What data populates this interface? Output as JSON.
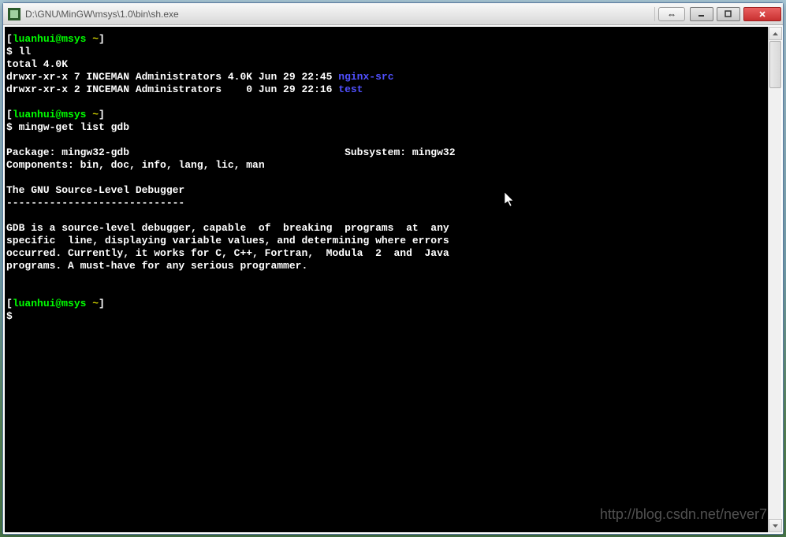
{
  "window": {
    "title": "D:\\GNU\\MinGW\\msys\\1.0\\bin\\sh.exe",
    "help_icon": "⇔"
  },
  "terminal": {
    "lines": [
      {
        "segs": [
          {
            "t": "[",
            "c": ""
          },
          {
            "t": "luanhui@msys ",
            "c": "green"
          },
          {
            "t": "~",
            "c": "yellow"
          },
          {
            "t": "]",
            "c": ""
          }
        ]
      },
      {
        "segs": [
          {
            "t": "$ ll",
            "c": ""
          }
        ]
      },
      {
        "segs": [
          {
            "t": "total 4.0K",
            "c": ""
          }
        ]
      },
      {
        "segs": [
          {
            "t": "drwxr-xr-x 7 INCEMAN Administrators 4.0K Jun 29 22:45 ",
            "c": ""
          },
          {
            "t": "nginx-src",
            "c": "blue"
          }
        ]
      },
      {
        "segs": [
          {
            "t": "drwxr-xr-x 2 INCEMAN Administrators    0 Jun 29 22:16 ",
            "c": ""
          },
          {
            "t": "test",
            "c": "blue"
          }
        ]
      },
      {
        "segs": [
          {
            "t": "",
            "c": ""
          }
        ]
      },
      {
        "segs": [
          {
            "t": "[",
            "c": ""
          },
          {
            "t": "luanhui@msys ",
            "c": "green"
          },
          {
            "t": "~",
            "c": "yellow"
          },
          {
            "t": "]",
            "c": ""
          }
        ]
      },
      {
        "segs": [
          {
            "t": "$ mingw-get list gdb",
            "c": ""
          }
        ]
      },
      {
        "segs": [
          {
            "t": "",
            "c": ""
          }
        ]
      },
      {
        "segs": [
          {
            "t": "Package: mingw32-gdb                                   Subsystem: mingw32",
            "c": ""
          }
        ]
      },
      {
        "segs": [
          {
            "t": "Components: bin, doc, info, lang, lic, man",
            "c": ""
          }
        ]
      },
      {
        "segs": [
          {
            "t": "",
            "c": ""
          }
        ]
      },
      {
        "segs": [
          {
            "t": "The GNU Source-Level Debugger",
            "c": ""
          }
        ]
      },
      {
        "segs": [
          {
            "t": "-----------------------------",
            "c": ""
          }
        ]
      },
      {
        "segs": [
          {
            "t": "",
            "c": ""
          }
        ]
      },
      {
        "segs": [
          {
            "t": "GDB is a source-level debugger, capable  of  breaking  programs  at  any",
            "c": ""
          }
        ]
      },
      {
        "segs": [
          {
            "t": "specific  line, displaying variable values, and determining where errors",
            "c": ""
          }
        ]
      },
      {
        "segs": [
          {
            "t": "occurred. Currently, it works for C, C++, Fortran,  Modula  2  and  Java",
            "c": ""
          }
        ]
      },
      {
        "segs": [
          {
            "t": "programs. A must-have for any serious programmer.",
            "c": ""
          }
        ]
      },
      {
        "segs": [
          {
            "t": "",
            "c": ""
          }
        ]
      },
      {
        "segs": [
          {
            "t": "",
            "c": ""
          }
        ]
      },
      {
        "segs": [
          {
            "t": "[",
            "c": ""
          },
          {
            "t": "luanhui@msys ",
            "c": "green"
          },
          {
            "t": "~",
            "c": "yellow"
          },
          {
            "t": "]",
            "c": ""
          }
        ]
      },
      {
        "segs": [
          {
            "t": "$",
            "c": ""
          }
        ]
      }
    ]
  },
  "watermark": "http://blog.csdn.net/never7"
}
